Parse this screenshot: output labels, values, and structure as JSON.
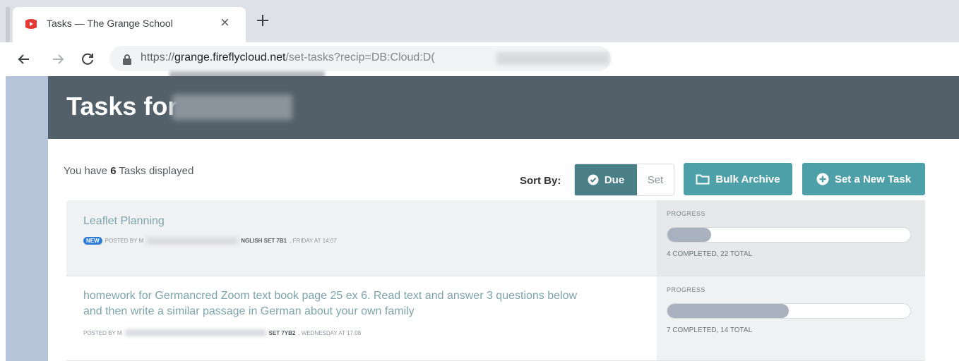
{
  "browser": {
    "tab_title": "Tasks — The Grange School",
    "tab_close": "×",
    "new_tab": "+",
    "url_scheme": "https://",
    "url_host": "grange.fireflycloud.net",
    "url_path": "/set-tasks?recip=DB:Cloud:D("
  },
  "header": {
    "title": "Tasks for"
  },
  "summary": {
    "prefix": "You have ",
    "count": "6",
    "suffix": " Tasks displayed"
  },
  "sort": {
    "label": "Sort By:",
    "due": "Due",
    "set": "Set"
  },
  "actions": {
    "bulk_archive": "Bulk Archive",
    "new_task": "Set a New Task"
  },
  "tasks": [
    {
      "title": "Leaflet Planning",
      "badge": "NEW",
      "posted_prefix": "POSTED BY M",
      "class": "NGLISH SET 7B1",
      "when": ", FRIDAY AT 14:07",
      "progress_label": "PROGRESS",
      "progress_fraction": 0.18,
      "progress_text": "4 COMPLETED, 22 TOTAL"
    },
    {
      "title": "homework for Germancred Zoom text book page 25 ex 6. Read text and answer 3 questions below and then write a similar passage in German about your own family",
      "posted_prefix": "POSTED BY M",
      "class": "SET 7YB2",
      "when": ", WEDNESDAY AT 17:08",
      "progress_label": "PROGRESS",
      "progress_fraction": 0.5,
      "progress_text": "7 COMPLETED, 14 TOTAL"
    }
  ],
  "colors": {
    "header_bg": "#535f69",
    "accent": "#4ea0a8",
    "sort_active": "#4a7f88",
    "link": "#7da4ab",
    "new_badge": "#2d7bd6"
  }
}
